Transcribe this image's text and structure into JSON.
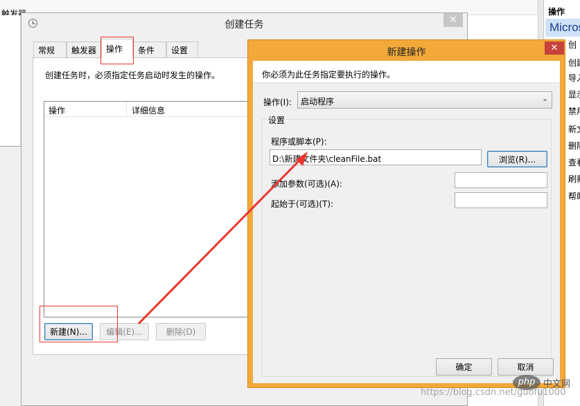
{
  "background": {
    "trigger_col": "触发器",
    "ops_header": "操作",
    "microsoft_text": "Micros",
    "right_items": [
      "创",
      "创建",
      "导入",
      "显示",
      "禁用",
      "新文",
      "删除",
      "查看",
      "刷新",
      "帮助"
    ]
  },
  "create_task": {
    "title": "创建任务",
    "tabs": [
      "常规",
      "触发器",
      "操作",
      "条件",
      "设置"
    ],
    "description": "创建任务时，必须指定任务启动时发生的操作。",
    "table_headers": [
      "操作",
      "详细信息"
    ],
    "buttons": {
      "new": "新建(N)...",
      "edit": "编辑(E)...",
      "delete": "删除(D)"
    }
  },
  "new_action": {
    "title": "新建操作",
    "description": "你必须为此任务指定要执行的操作。",
    "action_label": "操作(I):",
    "action_value": "启动程序",
    "group_label": "设置",
    "program_label": "程序或脚本(P):",
    "program_value": "D:\\新建文件夹\\cleanFile.bat",
    "browse_button": "浏览(R)...",
    "args_label": "添加参数(可选)(A):",
    "args_value": "",
    "start_label": "起始于(可选)(T):",
    "start_value": "",
    "ok_button": "确定",
    "cancel_button": "取消"
  },
  "watermark": {
    "logo": "php",
    "logo_text": "中文网",
    "url": "https://blog.csdn.net/guofu1000"
  },
  "colors": {
    "titlebar_orange": "#f3a93a",
    "close_red": "#c7423a",
    "annotation_red": "#e8362c"
  }
}
